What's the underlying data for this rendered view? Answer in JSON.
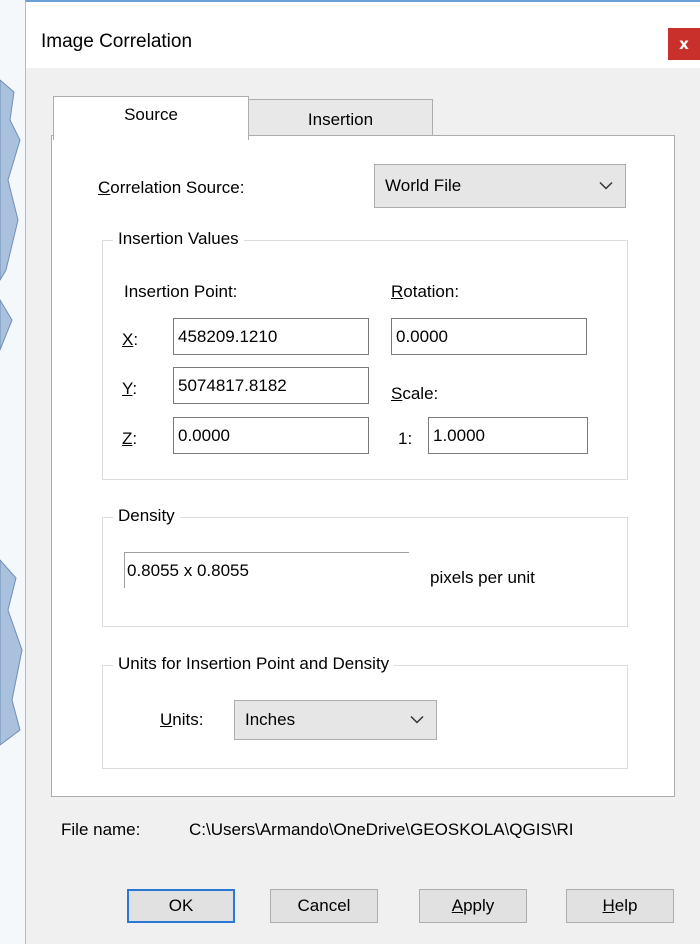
{
  "window": {
    "title": "Image Correlation",
    "close_label": "x"
  },
  "tabs": [
    {
      "label": "Source",
      "active": true
    },
    {
      "label": "Insertion",
      "active": false
    }
  ],
  "correlation_source": {
    "label_prefix": "C",
    "label_rest": "orrelation Source:",
    "selected": "World File"
  },
  "insertion_values": {
    "group_label": "Insertion Values",
    "insertion_point_label": "Insertion Point:",
    "x_label_key": "X",
    "x_label_colon": ":",
    "x_value": "458209.1210",
    "y_label_key": "Y",
    "y_label_colon": ":",
    "y_value": "5074817.8182",
    "z_label_key": "Z",
    "z_label_colon": ":",
    "z_value": "0.0000",
    "rotation_label_key": "R",
    "rotation_label_rest": "otation:",
    "rotation_value": "0.0000",
    "scale_label_key": "S",
    "scale_label_rest": "cale:",
    "scale_prefix": "1:",
    "scale_value": "1.0000"
  },
  "density": {
    "group_label": "Density",
    "value": "0.8055 x 0.8055",
    "units_text": "pixels per unit"
  },
  "units": {
    "group_label": "Units for Insertion Point and Density",
    "label_key": "U",
    "label_rest": "nits:",
    "selected": "Inches"
  },
  "file": {
    "label": "File name:",
    "path": "C:\\Users\\Armando\\OneDrive\\GEOSKOLA\\QGIS\\RI"
  },
  "buttons": {
    "ok": "OK",
    "cancel": "Cancel",
    "apply_key": "A",
    "apply_rest": "pply",
    "help_key": "H",
    "help_rest": "elp"
  },
  "colors": {
    "close_button": "#c9302c",
    "default_button_border": "#2a78d6",
    "dialog_background": "#f0f0f0"
  }
}
